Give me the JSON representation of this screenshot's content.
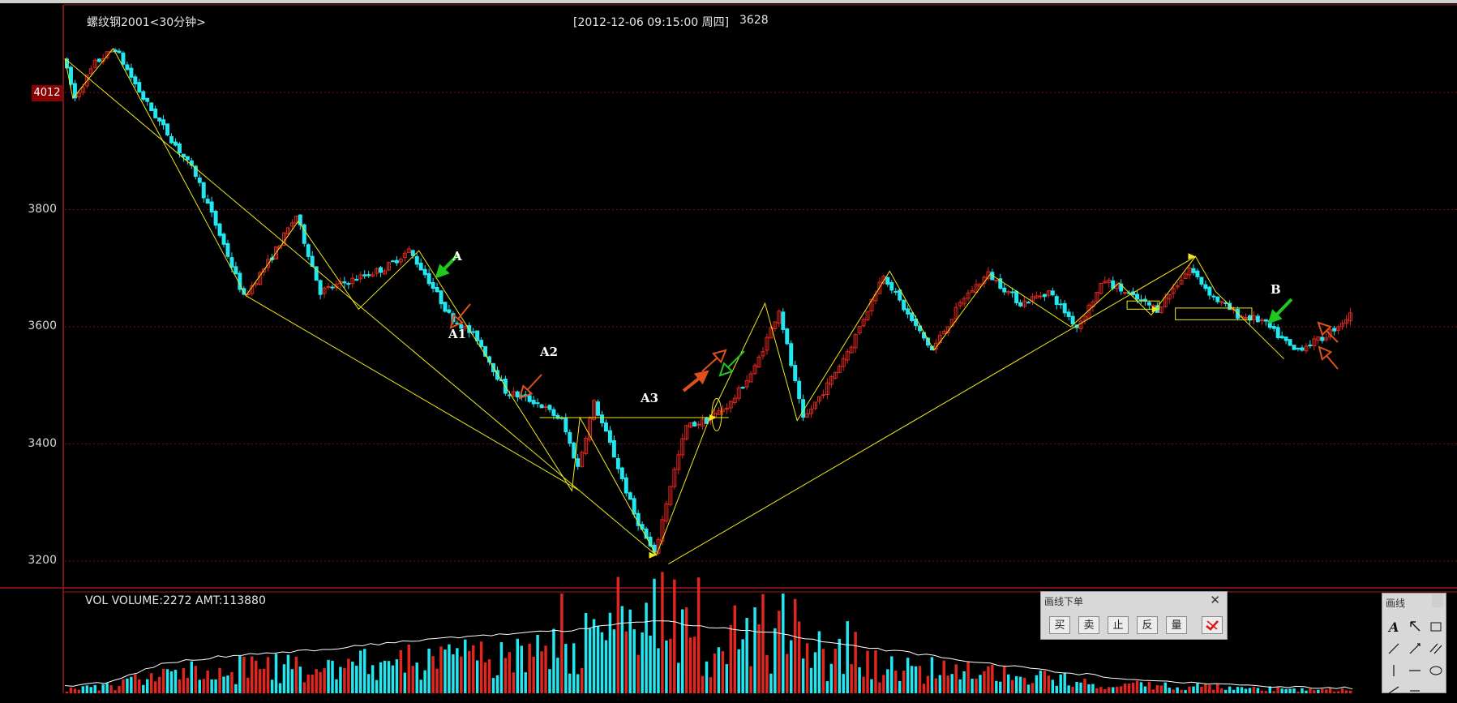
{
  "header": {
    "title": "螺纹钢2001<30分钟>",
    "datetime": "[2012-12-06  09:15:00 周四]",
    "price": "3628"
  },
  "price_tag": "4012",
  "volume_header": "VOL  VOLUME:2272 AMT:113880",
  "annotations": {
    "a": "A",
    "a1": "A1",
    "a2": "A2",
    "a3": "A3",
    "b": "B"
  },
  "order_panel": {
    "title": "画线下单",
    "close_glyph": "✕",
    "buttons": [
      "买",
      "卖",
      "止",
      "反",
      "量"
    ]
  },
  "draw_panel": {
    "title": "画线"
  },
  "colors": {
    "bull": "#e0261f",
    "bear": "#22e6f0",
    "trend": "#f0e81e",
    "volume_ma": "#ffffff",
    "grid": "#7a0f0f",
    "frame": "#9b1b1b"
  },
  "chart_data": {
    "type": "candlestick",
    "symbol": "螺纹钢2001",
    "period": "30分钟",
    "y_ticks": [
      3200,
      3400,
      3600,
      3800
    ],
    "ylim": [
      3180,
      4100
    ],
    "current_price_tag": 4012,
    "price_path": [
      [
        0,
        4060
      ],
      [
        3,
        3990
      ],
      [
        8,
        4050
      ],
      [
        13,
        4075
      ],
      [
        20,
        3990
      ],
      [
        27,
        3920
      ],
      [
        33,
        3860
      ],
      [
        40,
        3740
      ],
      [
        45,
        3650
      ],
      [
        52,
        3720
      ],
      [
        58,
        3790
      ],
      [
        64,
        3660
      ],
      [
        72,
        3680
      ],
      [
        80,
        3700
      ],
      [
        86,
        3730
      ],
      [
        90,
        3690
      ],
      [
        96,
        3620
      ],
      [
        103,
        3580
      ],
      [
        110,
        3490
      ],
      [
        118,
        3470
      ],
      [
        124,
        3440
      ],
      [
        128,
        3360
      ],
      [
        132,
        3470
      ],
      [
        136,
        3400
      ],
      [
        142,
        3280
      ],
      [
        147,
        3210
      ],
      [
        151,
        3330
      ],
      [
        155,
        3430
      ],
      [
        160,
        3440
      ],
      [
        166,
        3470
      ],
      [
        172,
        3530
      ],
      [
        178,
        3630
      ],
      [
        184,
        3440
      ],
      [
        190,
        3500
      ],
      [
        196,
        3570
      ],
      [
        204,
        3690
      ],
      [
        210,
        3620
      ],
      [
        216,
        3560
      ],
      [
        224,
        3650
      ],
      [
        230,
        3690
      ],
      [
        238,
        3640
      ],
      [
        245,
        3660
      ],
      [
        252,
        3600
      ],
      [
        259,
        3680
      ],
      [
        266,
        3650
      ],
      [
        272,
        3630
      ],
      [
        280,
        3700
      ],
      [
        286,
        3650
      ],
      [
        292,
        3620
      ],
      [
        298,
        3610
      ],
      [
        306,
        3560
      ],
      [
        313,
        3580
      ],
      [
        320,
        3620
      ]
    ],
    "trend_points": [
      [
        0,
        4058
      ],
      [
        2,
        3990
      ],
      [
        12,
        4075
      ],
      [
        45,
        3653
      ],
      [
        58,
        3780
      ],
      [
        73,
        3630
      ],
      [
        88,
        3730
      ],
      [
        126,
        3320
      ],
      [
        128,
        3445
      ],
      [
        147,
        3210
      ],
      [
        160,
        3440
      ],
      [
        174,
        3640
      ],
      [
        182,
        3440
      ],
      [
        205,
        3695
      ],
      [
        216,
        3560
      ],
      [
        230,
        3690
      ],
      [
        250,
        3600
      ],
      [
        262,
        3675
      ],
      [
        270,
        3620
      ],
      [
        281,
        3720
      ],
      [
        286,
        3660
      ],
      [
        303,
        3545
      ]
    ],
    "n_bars": 320,
    "volume_ma_profile": [
      [
        0,
        8
      ],
      [
        10,
        12
      ],
      [
        25,
        35
      ],
      [
        45,
        45
      ],
      [
        65,
        50
      ],
      [
        85,
        60
      ],
      [
        105,
        66
      ],
      [
        125,
        72
      ],
      [
        140,
        80
      ],
      [
        147,
        84
      ],
      [
        155,
        78
      ],
      [
        175,
        70
      ],
      [
        195,
        55
      ],
      [
        215,
        43
      ],
      [
        240,
        28
      ],
      [
        270,
        14
      ],
      [
        300,
        8
      ],
      [
        320,
        6
      ]
    ],
    "markers": [
      {
        "label": "A",
        "direction": "down",
        "color": "green",
        "at": [
          90,
          3690
        ]
      },
      {
        "label": "A1",
        "direction": "up",
        "color": "orange",
        "at": [
          94,
          3620
        ]
      },
      {
        "label": "A2",
        "direction": "up",
        "color": "orange",
        "at": [
          118,
          3480
        ]
      },
      {
        "label": "A3",
        "direction": "up",
        "color": "orange",
        "at": [
          158,
          3450
        ]
      },
      {
        "label": "B",
        "direction": "down",
        "color": "green",
        "at": [
          286,
          3605
        ]
      }
    ]
  }
}
